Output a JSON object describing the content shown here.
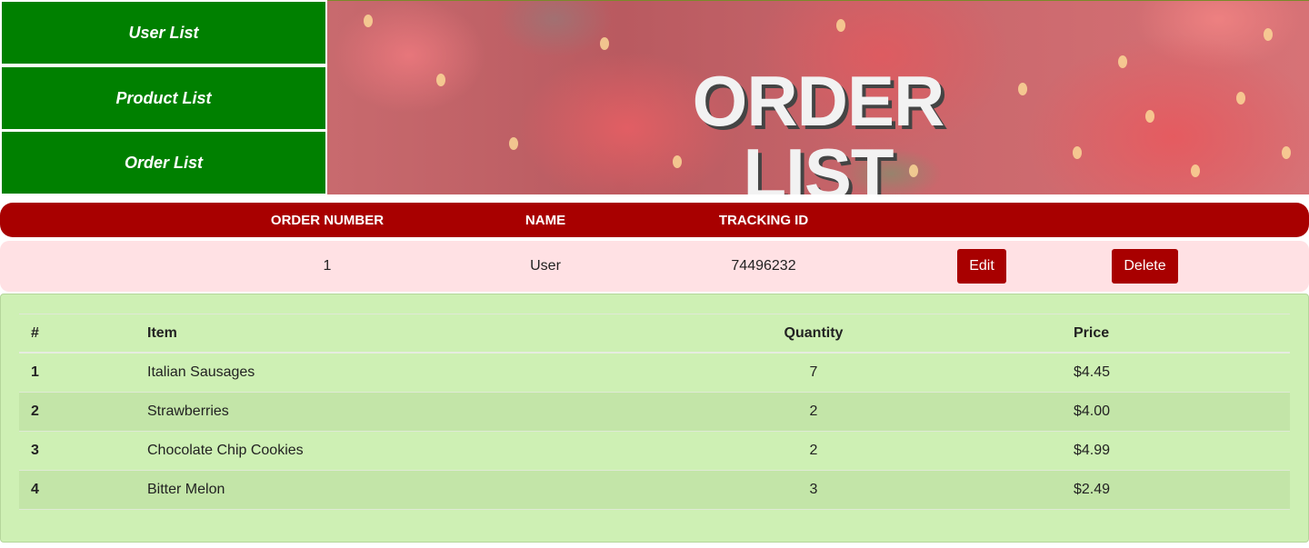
{
  "nav": {
    "items": [
      {
        "label": "User List"
      },
      {
        "label": "Product List"
      },
      {
        "label": "Order List"
      }
    ]
  },
  "hero": {
    "title": "ORDER LIST",
    "background": "strawberry-photo"
  },
  "orders_table": {
    "columns": [
      "ORDER NUMBER",
      "NAME",
      "TRACKING ID"
    ],
    "rows": [
      {
        "order_number": "1",
        "name": "User",
        "tracking_id": "74496232",
        "edit_label": "Edit",
        "delete_label": "Delete"
      }
    ]
  },
  "order_items": {
    "columns": [
      "#",
      "Item",
      "Quantity",
      "Price"
    ],
    "rows": [
      {
        "index": "1",
        "item": "Italian Sausages",
        "quantity": "7",
        "price": "$4.45"
      },
      {
        "index": "2",
        "item": "Strawberries",
        "quantity": "2",
        "price": "$4.00"
      },
      {
        "index": "3",
        "item": "Chocolate Chip Cookies",
        "quantity": "2",
        "price": "$4.99"
      },
      {
        "index": "4",
        "item": "Bitter Melon",
        "quantity": "3",
        "price": "$2.49"
      }
    ]
  },
  "colors": {
    "nav_green": "#008000",
    "accent_red": "#a80000",
    "row_pink": "#ffe1e4",
    "details_green": "#cef0b4"
  }
}
